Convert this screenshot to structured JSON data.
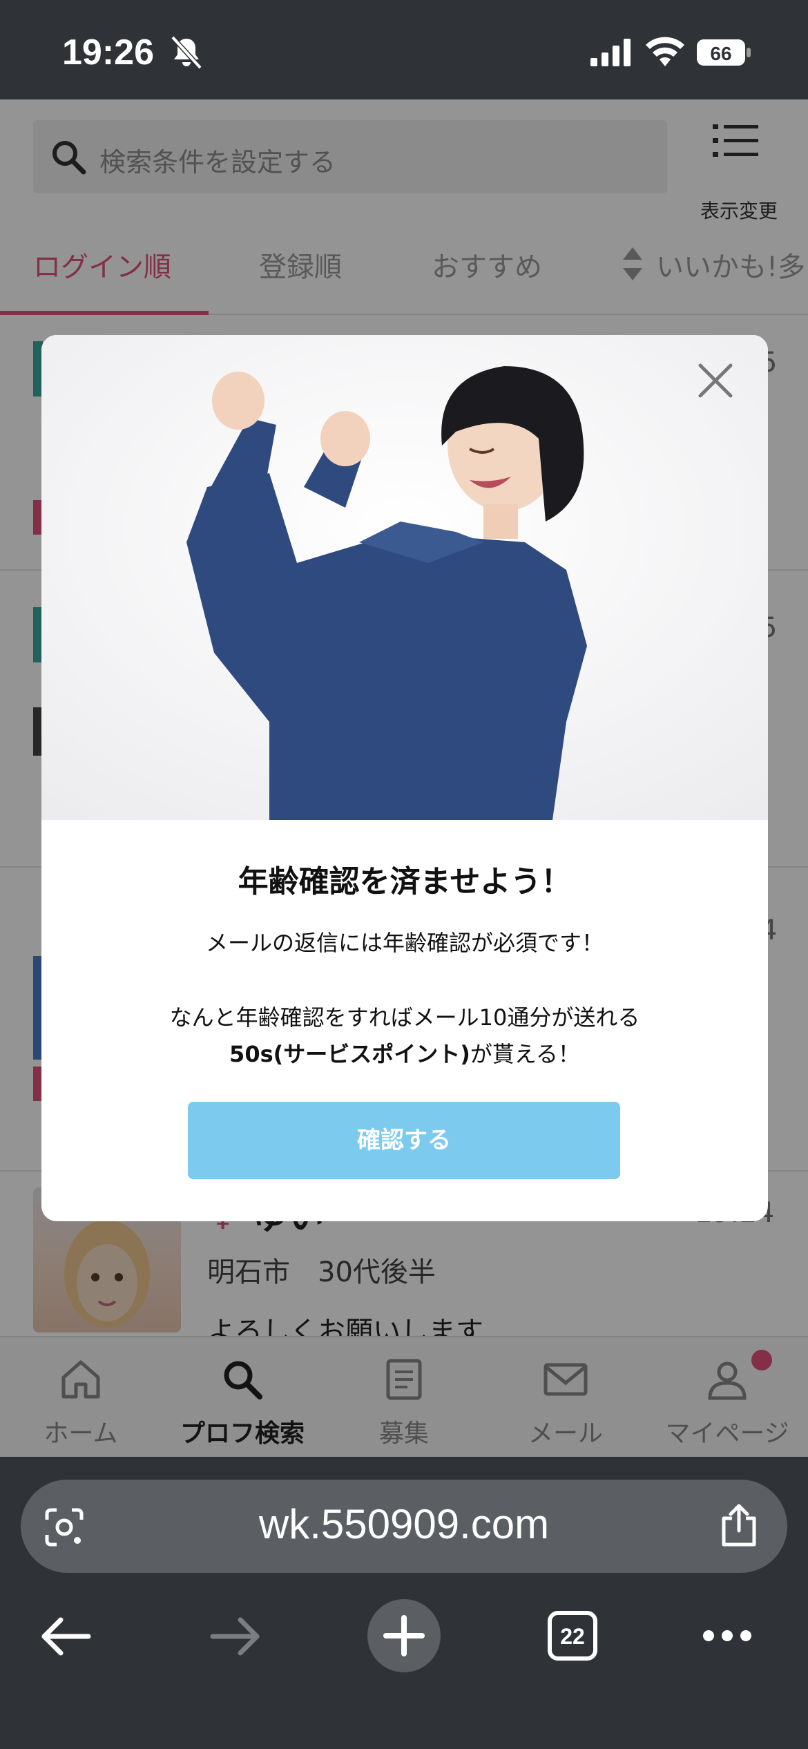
{
  "status_bar": {
    "time": "19:26",
    "battery": "66"
  },
  "search": {
    "placeholder": "検索条件を設定する",
    "view_toggle_label": "表示変更"
  },
  "tabs": [
    {
      "label": "ログイン順",
      "active": true
    },
    {
      "label": "登録順",
      "active": false
    },
    {
      "label": "おすすめ",
      "active": false
    },
    {
      "label": "いいかも!多",
      "active": false
    }
  ],
  "background_fragments": {
    "row1_time_fragment": "5",
    "row2_time_fragment": "5",
    "row3_time_fragment": "4"
  },
  "visible_user": {
    "gender_icon": "female-symbol",
    "name": "ゆい",
    "time": "19:24",
    "location": "明石市　30代後半",
    "message": "よろしくお願いします"
  },
  "bottom_nav": [
    {
      "label": "ホーム",
      "icon": "home-icon",
      "active": false
    },
    {
      "label": "プロフ検索",
      "icon": "search-icon",
      "active": true
    },
    {
      "label": "募集",
      "icon": "document-icon",
      "active": false
    },
    {
      "label": "メール",
      "icon": "mail-icon",
      "active": false
    },
    {
      "label": "マイページ",
      "icon": "person-icon",
      "active": false
    }
  ],
  "modal": {
    "title": "年齢確認を済ませよう！",
    "line1": "メールの返信には年齢確認が必須です！",
    "line2": "なんと年齢確認をすればメール10通分が送れる",
    "line3_bold": "50s(サービスポイント)",
    "line3_rest": "が貰える！",
    "button_label": "確認する"
  },
  "browser": {
    "url": "wk.550909.com",
    "tab_count": "22"
  },
  "colors": {
    "accent_pink": "#e0527a",
    "confirm_blue": "#7ccaee",
    "chrome_dark": "#2f3236"
  }
}
